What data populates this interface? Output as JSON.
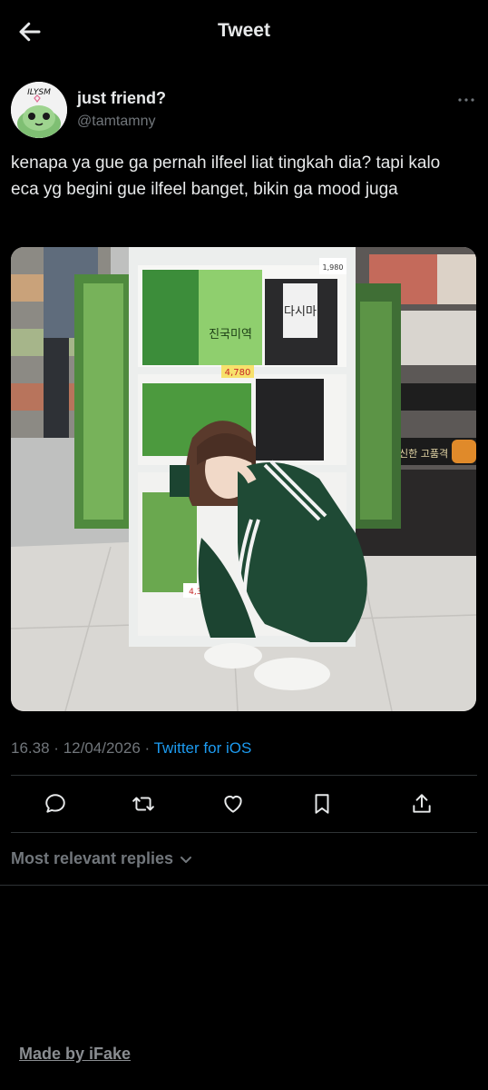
{
  "header": {
    "title": "Tweet"
  },
  "author": {
    "display_name": "just friend?",
    "handle": "@tamtamny",
    "avatar_text": "ILYSM"
  },
  "tweet": {
    "text": "kenapa ya gue ga pernah ilfeel liat tingkah dia? tapi kalo eca yg begini gue ilfeel banget, bikin ga mood juga",
    "time": "16.38",
    "date": "12/04/2026",
    "separator": "·",
    "client": "Twitter for iOS"
  },
  "photo": {
    "product_labels": [
      "다시마",
      "진국미역",
      "4,780",
      "1,980",
      "4,380",
      "신한 고품격"
    ]
  },
  "actions": [
    "reply-icon",
    "retweet-icon",
    "like-icon",
    "bookmark-icon",
    "share-icon"
  ],
  "replies": {
    "label": "Most relevant replies"
  },
  "watermark": "Made by iFake",
  "colors": {
    "background": "#000000",
    "text": "#e7e9ea",
    "muted": "#71767b",
    "link": "#1d9bf0",
    "divider": "#2f3336"
  }
}
